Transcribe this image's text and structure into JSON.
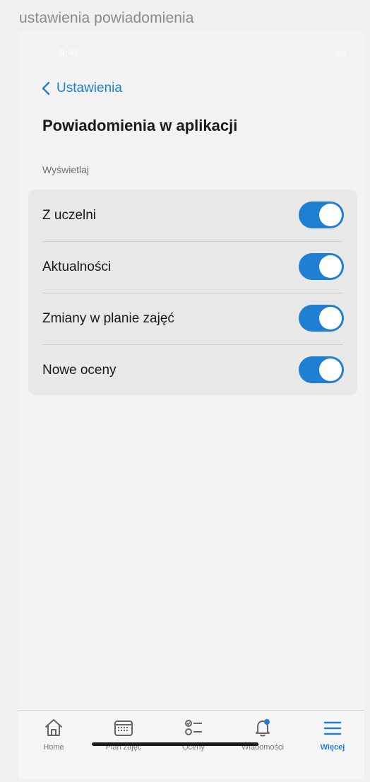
{
  "caption": "ustawienia powiadomienia",
  "status_bar": {
    "time": "9:41",
    "indicators": "all"
  },
  "header": {
    "back_label": "Ustawienia",
    "title": "Powiadomienia w aplikacji"
  },
  "section": {
    "label": "Wyświetlaj",
    "items": [
      {
        "label": "Z uczelni",
        "enabled": true
      },
      {
        "label": "Aktualności",
        "enabled": true
      },
      {
        "label": "Zmiany w planie zajęć",
        "enabled": true
      },
      {
        "label": "Nowe oceny",
        "enabled": true
      }
    ]
  },
  "tabbar": {
    "tabs": [
      {
        "label": "Home",
        "icon": "home-icon"
      },
      {
        "label": "Plan zajęć",
        "icon": "calendar-icon"
      },
      {
        "label": "Oceny",
        "icon": "checklist-icon"
      },
      {
        "label": "Wiadomości",
        "icon": "bell-icon"
      },
      {
        "label": "Więcej",
        "icon": "menu-icon",
        "active": true
      }
    ]
  },
  "colors": {
    "accent": "#1f7fd3",
    "link": "#1a7fd6",
    "card_background": "#e8e8e8",
    "page_background": "#f3f3f3"
  }
}
